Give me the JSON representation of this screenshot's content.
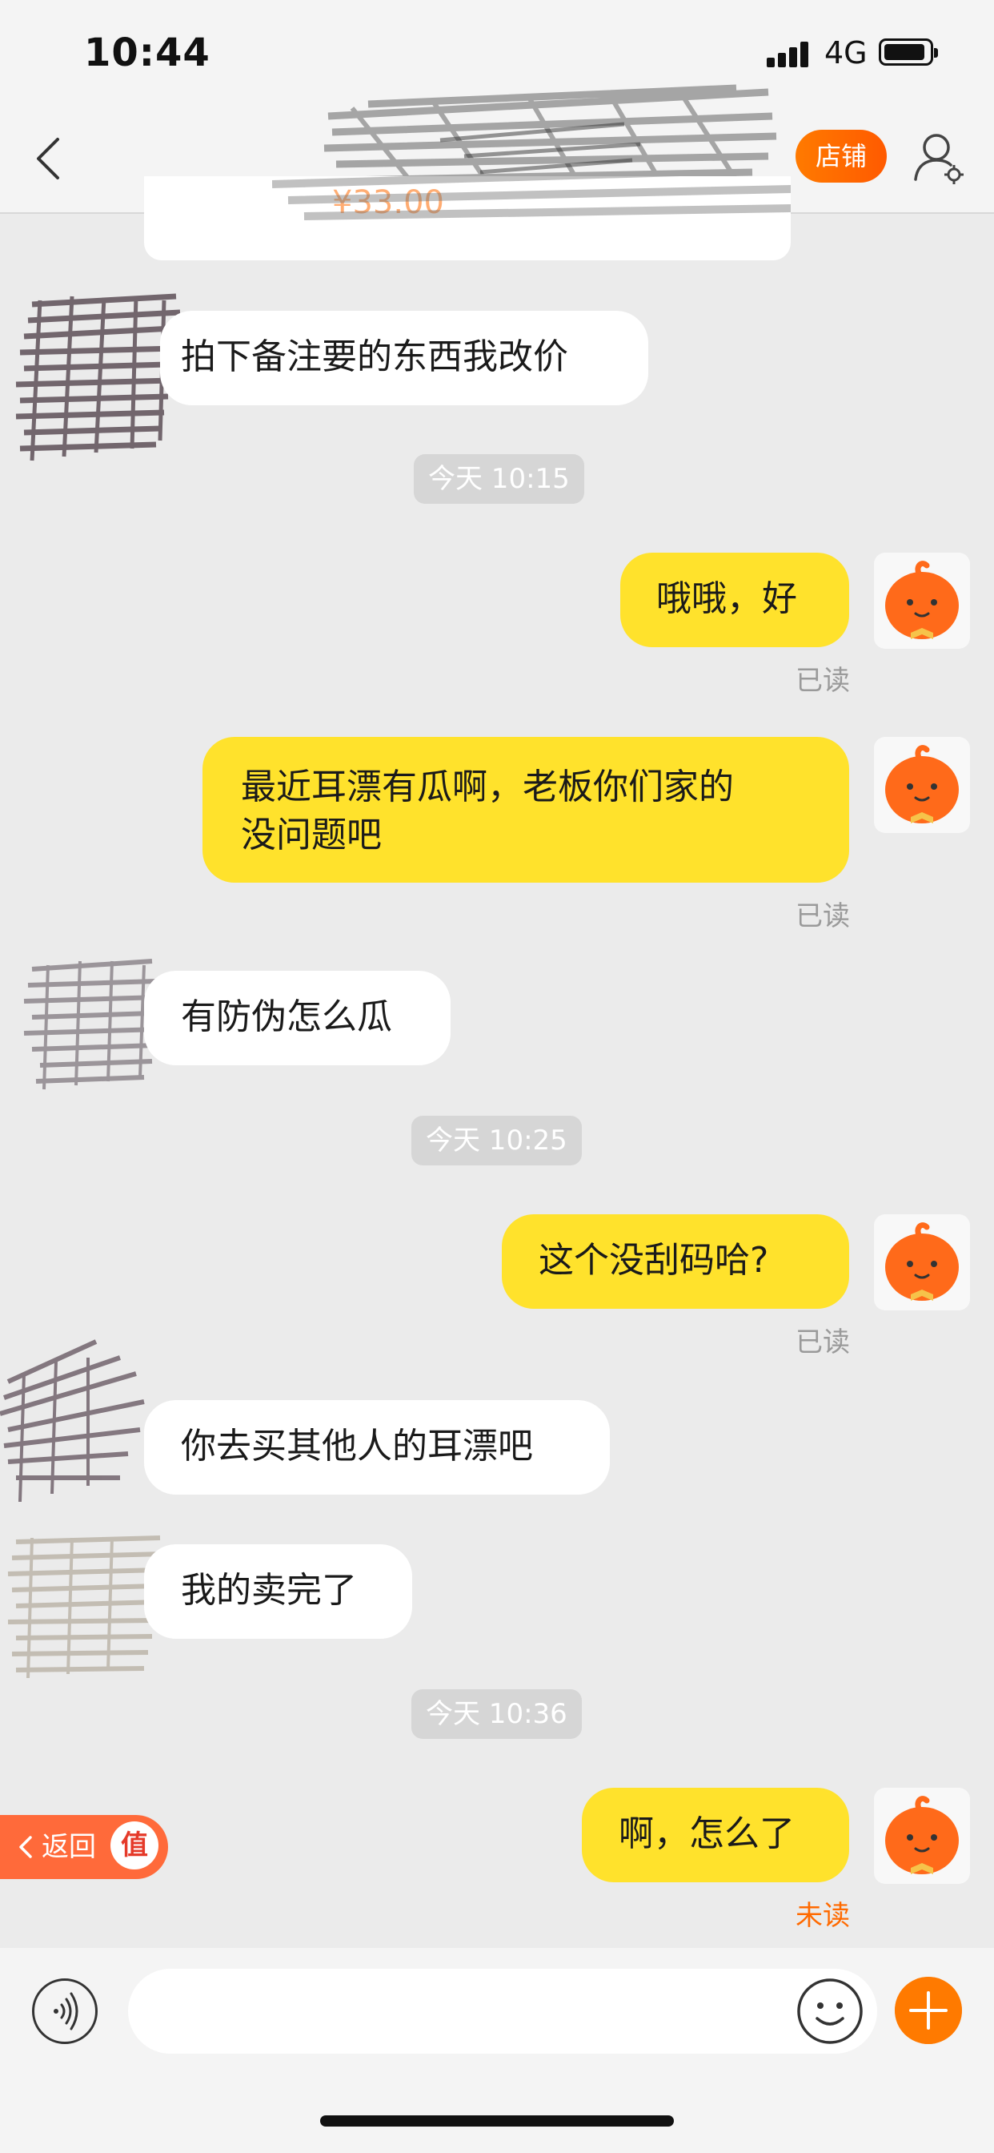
{
  "status_bar": {
    "time": "10:44",
    "network": "4G"
  },
  "nav": {
    "store_label": "店铺"
  },
  "product": {
    "price": "¥33.00"
  },
  "messages": [
    {
      "from": "seller",
      "text": "拍下备注要的东西我改价"
    },
    {
      "type": "timestamp",
      "text": "今天 10:15"
    },
    {
      "from": "me",
      "text": "哦哦，好",
      "status": "已读"
    },
    {
      "from": "me",
      "lines": [
        "最近耳漂有瓜啊，老板你们家的",
        "没问题吧"
      ],
      "status": "已读"
    },
    {
      "from": "seller",
      "text": "有防伪怎么瓜"
    },
    {
      "type": "timestamp",
      "text": "今天 10:25"
    },
    {
      "from": "me",
      "text": "这个没刮码哈?",
      "status": "已读"
    },
    {
      "from": "seller",
      "text": "你去买其他人的耳漂吧"
    },
    {
      "from": "seller",
      "text": "我的卖完了"
    },
    {
      "type": "timestamp",
      "text": "今天 10:36"
    },
    {
      "from": "me",
      "text": "啊，怎么了",
      "status": "未读"
    }
  ],
  "float_back": {
    "label": "返回",
    "badge": "值"
  },
  "input": {
    "placeholder": ""
  },
  "colors": {
    "accent": "#ff6a00",
    "my_bubble": "#ffe22c",
    "their_bubble": "#ffffff",
    "background": "#ebebeb"
  }
}
